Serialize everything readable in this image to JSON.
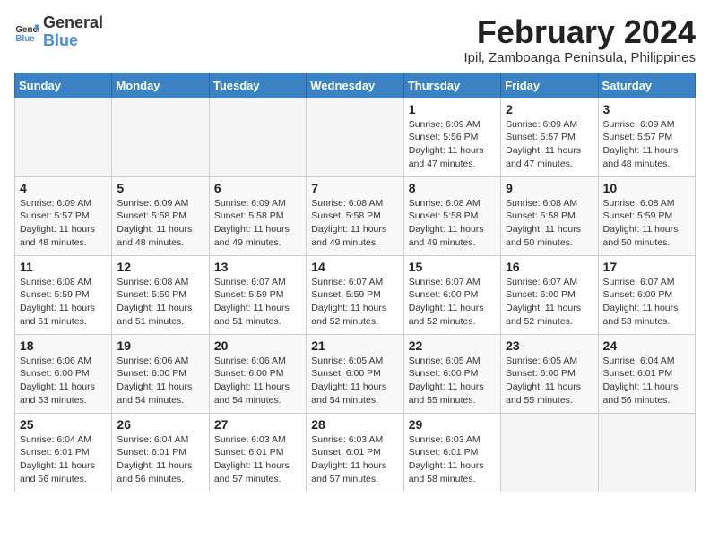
{
  "app": {
    "name_general": "General",
    "name_blue": "Blue"
  },
  "calendar": {
    "title": "February 2024",
    "subtitle": "Ipil, Zamboanga Peninsula, Philippines",
    "days_of_week": [
      "Sunday",
      "Monday",
      "Tuesday",
      "Wednesday",
      "Thursday",
      "Friday",
      "Saturday"
    ],
    "weeks": [
      [
        {
          "day": "",
          "info": ""
        },
        {
          "day": "",
          "info": ""
        },
        {
          "day": "",
          "info": ""
        },
        {
          "day": "",
          "info": ""
        },
        {
          "day": "1",
          "info": "Sunrise: 6:09 AM\nSunset: 5:56 PM\nDaylight: 11 hours\nand 47 minutes."
        },
        {
          "day": "2",
          "info": "Sunrise: 6:09 AM\nSunset: 5:57 PM\nDaylight: 11 hours\nand 47 minutes."
        },
        {
          "day": "3",
          "info": "Sunrise: 6:09 AM\nSunset: 5:57 PM\nDaylight: 11 hours\nand 48 minutes."
        }
      ],
      [
        {
          "day": "4",
          "info": "Sunrise: 6:09 AM\nSunset: 5:57 PM\nDaylight: 11 hours\nand 48 minutes."
        },
        {
          "day": "5",
          "info": "Sunrise: 6:09 AM\nSunset: 5:58 PM\nDaylight: 11 hours\nand 48 minutes."
        },
        {
          "day": "6",
          "info": "Sunrise: 6:09 AM\nSunset: 5:58 PM\nDaylight: 11 hours\nand 49 minutes."
        },
        {
          "day": "7",
          "info": "Sunrise: 6:08 AM\nSunset: 5:58 PM\nDaylight: 11 hours\nand 49 minutes."
        },
        {
          "day": "8",
          "info": "Sunrise: 6:08 AM\nSunset: 5:58 PM\nDaylight: 11 hours\nand 49 minutes."
        },
        {
          "day": "9",
          "info": "Sunrise: 6:08 AM\nSunset: 5:58 PM\nDaylight: 11 hours\nand 50 minutes."
        },
        {
          "day": "10",
          "info": "Sunrise: 6:08 AM\nSunset: 5:59 PM\nDaylight: 11 hours\nand 50 minutes."
        }
      ],
      [
        {
          "day": "11",
          "info": "Sunrise: 6:08 AM\nSunset: 5:59 PM\nDaylight: 11 hours\nand 51 minutes."
        },
        {
          "day": "12",
          "info": "Sunrise: 6:08 AM\nSunset: 5:59 PM\nDaylight: 11 hours\nand 51 minutes."
        },
        {
          "day": "13",
          "info": "Sunrise: 6:07 AM\nSunset: 5:59 PM\nDaylight: 11 hours\nand 51 minutes."
        },
        {
          "day": "14",
          "info": "Sunrise: 6:07 AM\nSunset: 5:59 PM\nDaylight: 11 hours\nand 52 minutes."
        },
        {
          "day": "15",
          "info": "Sunrise: 6:07 AM\nSunset: 6:00 PM\nDaylight: 11 hours\nand 52 minutes."
        },
        {
          "day": "16",
          "info": "Sunrise: 6:07 AM\nSunset: 6:00 PM\nDaylight: 11 hours\nand 52 minutes."
        },
        {
          "day": "17",
          "info": "Sunrise: 6:07 AM\nSunset: 6:00 PM\nDaylight: 11 hours\nand 53 minutes."
        }
      ],
      [
        {
          "day": "18",
          "info": "Sunrise: 6:06 AM\nSunset: 6:00 PM\nDaylight: 11 hours\nand 53 minutes."
        },
        {
          "day": "19",
          "info": "Sunrise: 6:06 AM\nSunset: 6:00 PM\nDaylight: 11 hours\nand 54 minutes."
        },
        {
          "day": "20",
          "info": "Sunrise: 6:06 AM\nSunset: 6:00 PM\nDaylight: 11 hours\nand 54 minutes."
        },
        {
          "day": "21",
          "info": "Sunrise: 6:05 AM\nSunset: 6:00 PM\nDaylight: 11 hours\nand 54 minutes."
        },
        {
          "day": "22",
          "info": "Sunrise: 6:05 AM\nSunset: 6:00 PM\nDaylight: 11 hours\nand 55 minutes."
        },
        {
          "day": "23",
          "info": "Sunrise: 6:05 AM\nSunset: 6:00 PM\nDaylight: 11 hours\nand 55 minutes."
        },
        {
          "day": "24",
          "info": "Sunrise: 6:04 AM\nSunset: 6:01 PM\nDaylight: 11 hours\nand 56 minutes."
        }
      ],
      [
        {
          "day": "25",
          "info": "Sunrise: 6:04 AM\nSunset: 6:01 PM\nDaylight: 11 hours\nand 56 minutes."
        },
        {
          "day": "26",
          "info": "Sunrise: 6:04 AM\nSunset: 6:01 PM\nDaylight: 11 hours\nand 56 minutes."
        },
        {
          "day": "27",
          "info": "Sunrise: 6:03 AM\nSunset: 6:01 PM\nDaylight: 11 hours\nand 57 minutes."
        },
        {
          "day": "28",
          "info": "Sunrise: 6:03 AM\nSunset: 6:01 PM\nDaylight: 11 hours\nand 57 minutes."
        },
        {
          "day": "29",
          "info": "Sunrise: 6:03 AM\nSunset: 6:01 PM\nDaylight: 11 hours\nand 58 minutes."
        },
        {
          "day": "",
          "info": ""
        },
        {
          "day": "",
          "info": ""
        }
      ]
    ]
  }
}
